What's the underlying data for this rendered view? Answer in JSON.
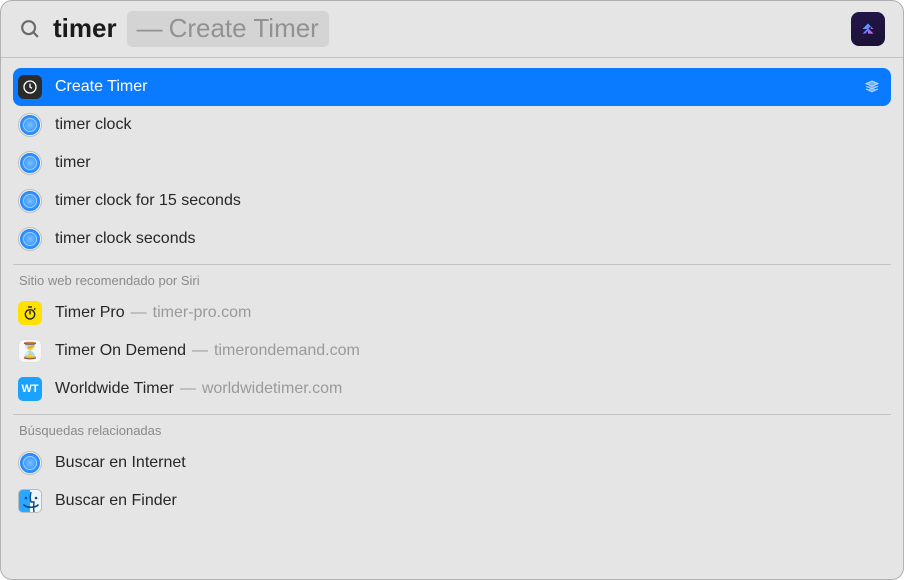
{
  "search": {
    "query": "timer",
    "completion": "Create Timer",
    "app_badge": "shortcuts"
  },
  "sections": [
    {
      "items": [
        {
          "kind": "app",
          "icon": "clock-app-icon",
          "title": "Create Timer",
          "selected": true,
          "trailing": "layers-icon"
        },
        {
          "kind": "safari",
          "icon": "safari-icon",
          "title": "timer clock"
        },
        {
          "kind": "safari",
          "icon": "safari-icon",
          "title": "timer"
        },
        {
          "kind": "safari",
          "icon": "safari-icon",
          "title": "timer clock for 15 seconds"
        },
        {
          "kind": "safari",
          "icon": "safari-icon",
          "title": "timer clock seconds"
        }
      ]
    },
    {
      "header": "Sitio web recomendado por Siri",
      "items": [
        {
          "kind": "website",
          "icon": "stopwatch-icon",
          "title": "Timer Pro",
          "sub": "timer-pro.com"
        },
        {
          "kind": "website",
          "icon": "hourglass-icon",
          "title": "Timer On Demend",
          "sub": "timerondemand.com"
        },
        {
          "kind": "website",
          "icon": "wt-icon",
          "title": "Worldwide Timer",
          "sub": "worldwidetimer.com"
        }
      ]
    },
    {
      "header": "Búsquedas relacionadas",
      "items": [
        {
          "kind": "action",
          "icon": "safari-icon",
          "title": "Buscar en Internet"
        },
        {
          "kind": "action",
          "icon": "finder-icon",
          "title": "Buscar en Finder"
        }
      ]
    }
  ],
  "icons": {
    "wt_text": "WT"
  }
}
